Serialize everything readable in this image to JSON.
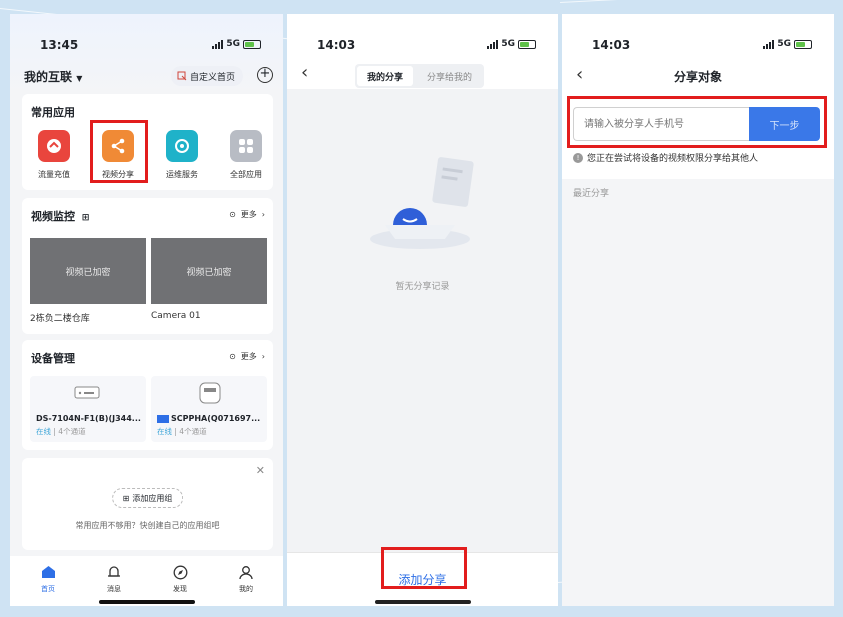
{
  "colors": {
    "accent": "#2e6fe6",
    "highlight": "#e21d1d",
    "online": "#3ea6d8"
  },
  "screen1": {
    "status": {
      "time": "13:45",
      "network": "5G"
    },
    "header": {
      "title": "我的互联",
      "dropdown_icon": "caret-down-icon",
      "custom_home": "自定义首页",
      "add_icon": "plus-circle-icon"
    },
    "common_apps": {
      "title": "常用应用",
      "items": [
        {
          "label": "流量充值",
          "icon": "data-topup-icon",
          "color": "#e9453d"
        },
        {
          "label": "视频分享",
          "icon": "share-icon",
          "color": "#f08a36"
        },
        {
          "label": "运维服务",
          "icon": "maintenance-icon",
          "color": "#1fb2c9"
        },
        {
          "label": "全部应用",
          "icon": "grid-icon",
          "color": "#b8bcc4"
        }
      ]
    },
    "video_monitor": {
      "title": "视频监控",
      "more": "更多",
      "cameras": [
        {
          "thumb_text": "视频已加密",
          "name": "2栋负二楼仓库"
        },
        {
          "thumb_text": "视频已加密",
          "name": "Camera 01"
        }
      ]
    },
    "device_mgmt": {
      "title": "设备管理",
      "more": "更多",
      "devices": [
        {
          "name": "DS-7104N-F1(B)(J344...",
          "status": "在线",
          "channels": "4个通道"
        },
        {
          "name": "SCPPHA(Q071697...",
          "status": "在线",
          "channels": "4个通道"
        }
      ]
    },
    "app_group": {
      "button": "添加应用组",
      "desc": "常用应用不够用？快创建自己的应用组吧"
    },
    "tabbar": [
      {
        "label": "首页",
        "icon": "home-icon"
      },
      {
        "label": "消息",
        "icon": "bell-icon"
      },
      {
        "label": "发现",
        "icon": "compass-icon"
      },
      {
        "label": "我的",
        "icon": "user-icon"
      }
    ]
  },
  "screen2": {
    "status": {
      "time": "14:03",
      "network": "5G"
    },
    "tabs": [
      "我的分享",
      "分享给我的"
    ],
    "empty_text": "暂无分享记录",
    "add_button": "添加分享"
  },
  "screen3": {
    "status": {
      "time": "14:03",
      "network": "5G"
    },
    "title": "分享对象",
    "input_placeholder": "请输入被分享人手机号",
    "next_button": "下一步",
    "hint": "您正在尝试将设备的视频权限分享给其他人",
    "recent_label": "最近分享"
  }
}
